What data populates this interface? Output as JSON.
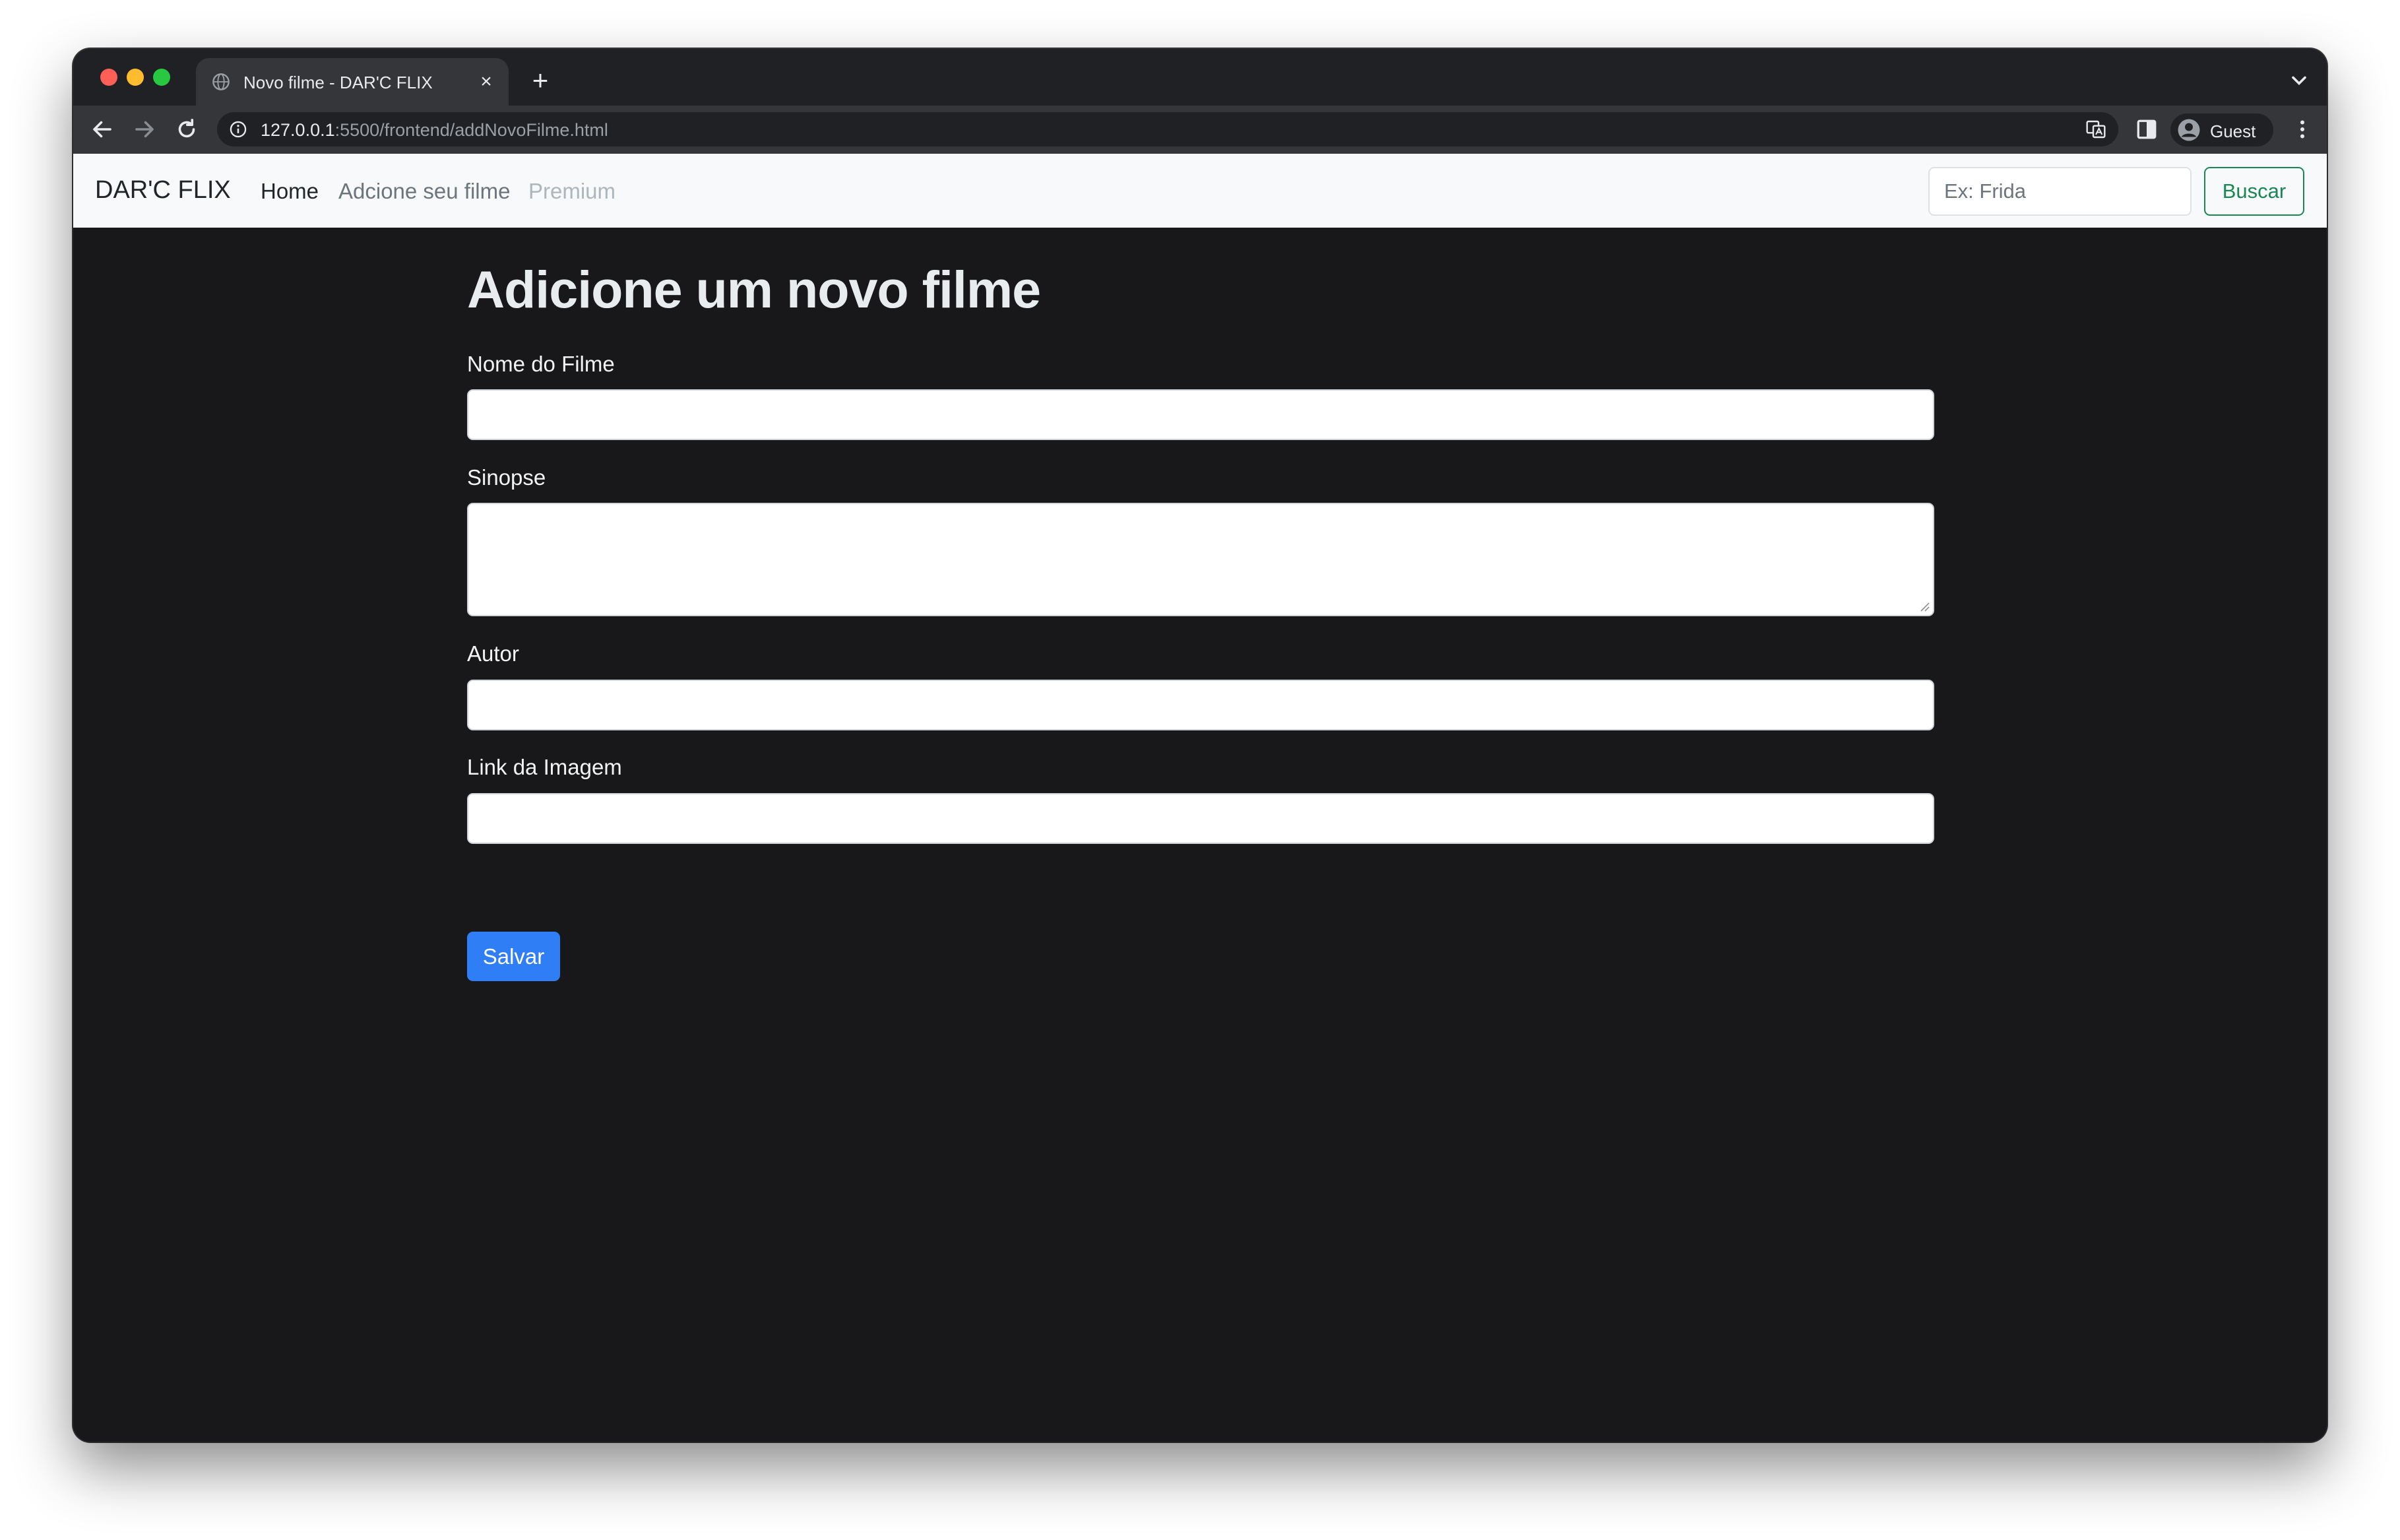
{
  "browser": {
    "tab": {
      "title": "Novo filme - DAR'C FLIX",
      "close_glyph": "×"
    },
    "new_tab_glyph": "+",
    "address": {
      "host": "127.0.0.1",
      "path": ":5500/frontend/addNovoFilme.html"
    },
    "profile": {
      "label": "Guest"
    },
    "icons": [
      "globe-icon",
      "chevron-down-icon",
      "back-arrow-icon",
      "forward-arrow-icon",
      "reload-icon",
      "info-icon",
      "translate-icon",
      "side-panel-icon",
      "avatar-icon",
      "kebab-menu-icon"
    ]
  },
  "navbar": {
    "brand": "DAR'C FLIX",
    "links": {
      "home": "Home",
      "add": "Adcione seu filme",
      "premium": "Premium"
    },
    "search": {
      "placeholder": "Ex: Frida",
      "value": "",
      "button": "Buscar"
    }
  },
  "form": {
    "title": "Adicione um novo filme",
    "fields": {
      "name": {
        "label": "Nome do Filme",
        "value": ""
      },
      "synopsis": {
        "label": "Sinopse",
        "value": ""
      },
      "author": {
        "label": "Autor",
        "value": ""
      },
      "image_link": {
        "label": "Link da Imagem",
        "value": ""
      }
    },
    "submit": "Salvar"
  },
  "colors": {
    "page_background": "#18181b",
    "navbar_background": "#f8f9fa",
    "search_button": "#198754",
    "save_button": "#2f7ef5"
  }
}
